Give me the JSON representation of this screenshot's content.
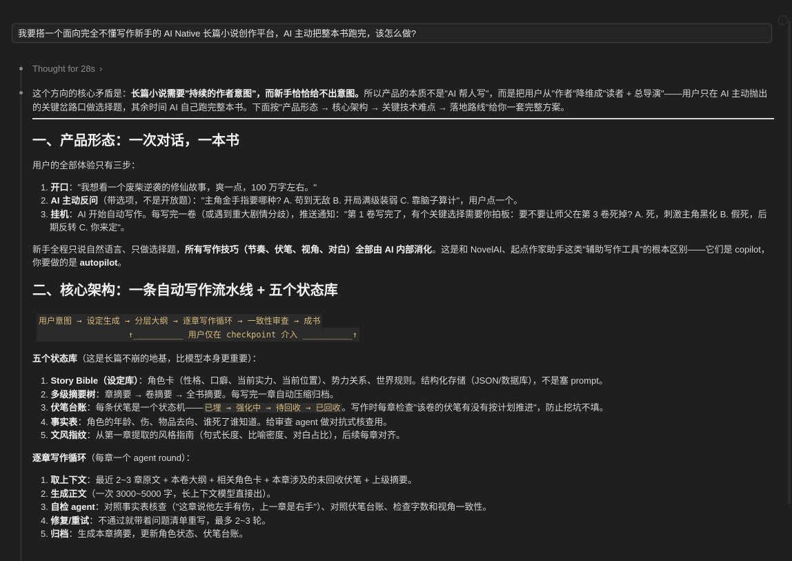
{
  "prompt": {
    "text": "我要搭一个面向完全不懂写作新手的 AI Native 长篇小说创作平台，AI 主动把整本书跑完，该怎么做?"
  },
  "thought": {
    "label": "Thought for 28s",
    "chevron": "›"
  },
  "intro": {
    "a": "这个方向的核心矛盾是：",
    "b": "长篇小说需要\"持续的作者意图\"，而新手恰恰给不出意图。",
    "c": "所以产品的本质不是\"AI 帮人写\"，而是把用户从\"作者\"降维成\"读者 + 总导演\"——用户只在 AI 主动抛出的关键岔路口做选择题，其余时间 AI 自己跑完整本书。下面按\"产品形态 → 核心架构 → 关键技术难点 → 落地路线\"给你一套完整方案。"
  },
  "section1": {
    "title": "一、产品形态：一次对话，一本书",
    "lead": "用户的全部体验只有三步：",
    "items": [
      {
        "num": "1.",
        "bold": "开口",
        "text": "：\"我想看一个废柴逆袭的修仙故事，爽一点，100 万字左右。\""
      },
      {
        "num": "2.",
        "bold": "AI 主动反问",
        "text": "（带选项，不是开放题）：\"主角金手指要哪种? A. 苟到无敌 B. 开局满级装弱 C. 靠脑子算计\"，用户点一个。"
      },
      {
        "num": "3.",
        "bold": "挂机",
        "text": "：AI 开始自动写作。每写完一卷（或遇到重大剧情分歧），推送通知：\"第 1 卷写完了，有个关键选择需要你拍板：要不要让师父在第 3 卷死掉? A. 死，刺激主角黑化 B. 假死，后期反转 C. 你来定\"。"
      }
    ],
    "para_a": "新手全程只说自然语言、只做选择题，",
    "para_b": "所有写作技巧（节奏、伏笔、视角、对白）全部由 AI 内部消化",
    "para_c": "。这是和 NovelAI、起点作家助手这类\"辅助写作工具\"的根本区别——它们是 copilot，你要做的是 ",
    "para_d": "autopilot",
    "para_e": "。"
  },
  "section2": {
    "title": "二、核心架构：一条自动写作流水线 + 五个状态库",
    "pipeline_line1": "用户意图 → 设定生成 → 分层大纲 → 逐章写作循环 → 一致性审查 → 成书",
    "pipeline_line2": "                  ↑__________ 用户仅在 checkpoint 介入 __________↑",
    "stores_head_bold": "五个状态库",
    "stores_head_rest": "（这是长篇不崩的地基，比模型本身更重要）：",
    "stores": [
      {
        "num": "1.",
        "bold": "Story Bible（设定库）",
        "text": "：角色卡（性格、口癖、当前实力、当前位置）、势力关系、世界规则。结构化存储（JSON/数据库），不是塞 prompt。"
      },
      {
        "num": "2.",
        "bold": "多级摘要树",
        "text": "：章摘要 → 卷摘要 → 全书摘要。每写完一章自动压缩归档。"
      },
      {
        "num": "3.",
        "bold": "伏笔台账",
        "text_a": "：每条伏笔是一个状态机——",
        "code": "已埋 → 强化中 → 待回收 → 已回收",
        "text_b": "。写作时每章检查\"该卷的伏笔有没有按计划推进\"，防止挖坑不填。"
      },
      {
        "num": "4.",
        "bold": "事实表",
        "text": "：角色的年龄、伤、物品去向、谁死了谁知道。给审查 agent 做对抗式核查用。"
      },
      {
        "num": "5.",
        "bold": "文风指纹",
        "text": "：从第一章提取的风格指南（句式长度、比喻密度、对白占比），后续每章对齐。"
      }
    ],
    "loop_head_bold": "逐章写作循环",
    "loop_head_rest": "（每章一个 agent round）：",
    "loop": [
      {
        "num": "1.",
        "bold": "取上下文",
        "text": "：最近 2~3 章原文 + 本卷大纲 + 相关角色卡 + 本章涉及的未回收伏笔 + 上级摘要。"
      },
      {
        "num": "2.",
        "bold": "生成正文",
        "text": "（一次 3000~5000 字，长上下文模型直接出）。"
      },
      {
        "num": "3.",
        "bold": "自检 agent",
        "text": "：对照事实表核查（\"这章说他左手有伤，上一章是右手\"）、对照伏笔台账、检查字数和视角一致性。"
      },
      {
        "num": "4.",
        "bold": "修复/重试",
        "text": "：不通过就带着问题清单重写，最多 2~3 轮。"
      },
      {
        "num": "5.",
        "bold": "归档",
        "text": "：生成本章摘要，更新角色状态、伏笔台账。"
      }
    ]
  },
  "colors": {
    "background": "#1f1f1f",
    "text": "#d4d4d4",
    "code_text": "#d7ba7d",
    "muted": "#8c8c8c"
  }
}
